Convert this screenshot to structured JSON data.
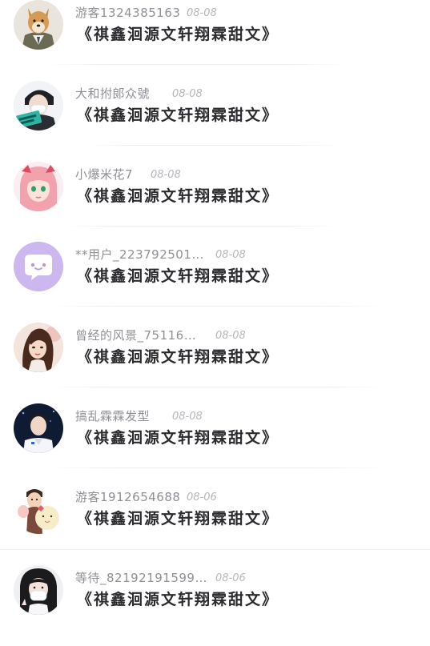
{
  "feed": {
    "items": [
      {
        "user": "游客1324385163",
        "date": "08-08",
        "book": "《祺鑫洄源文轩翔霖甜文》",
        "avatar_icon": "shiba-dog-avatar-icon"
      },
      {
        "user": "大和拊郞众號",
        "date": "08-08",
        "book": "《祺鑫洄源文轩翔霖甜文》",
        "avatar_icon": "boy-with-mask-avatar-icon"
      },
      {
        "user": "小爆米花7",
        "date": "08-08",
        "book": "《祺鑫洄源文轩翔霖甜文》",
        "avatar_icon": "anime-pink-hair-girl-avatar-icon"
      },
      {
        "user": "**用户_223792501…",
        "date": "08-08",
        "book": "《祺鑫洄源文轩翔霖甜文》",
        "avatar_icon": "default-chat-bubble-avatar-icon"
      },
      {
        "user": "曾经的风景_75116…",
        "date": "08-08",
        "book": "《祺鑫洄源文轩翔霖甜文》",
        "avatar_icon": "illustrated-woman-avatar-icon"
      },
      {
        "user": "搞乱霖霖发型",
        "date": "08-08",
        "book": "《祺鑫洄源文轩翔霖甜文》",
        "avatar_icon": "young-man-portrait-avatar-icon"
      },
      {
        "user": "游客1912654688",
        "date": "08-06",
        "book": "《祺鑫洄源文轩翔霖甜文》",
        "avatar_icon": "cartoon-couple-avatar-icon"
      },
      {
        "user": "等待_82192191599…",
        "date": "08-06",
        "book": "《祺鑫洄源文轩翔霖甜文》",
        "avatar_icon": "girl-with-face-mask-avatar-icon"
      }
    ]
  },
  "colors": {
    "username": "#8f8f96",
    "date": "#b5b5bb",
    "title": "#2b2b2f",
    "default_avatar_bg": "#cdb7ef",
    "divider": "#ececf1"
  }
}
